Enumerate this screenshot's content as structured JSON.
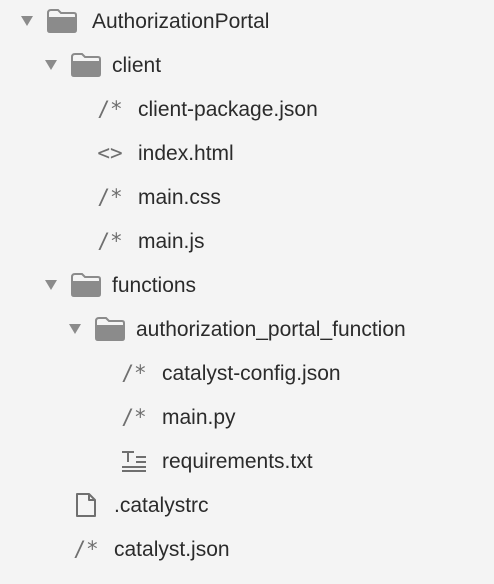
{
  "explorer": {
    "root": {
      "label": "AuthorizationPortal",
      "arrow_icon": "disclosure-expanded-icon",
      "folder_icon": "folder-icon"
    },
    "client": {
      "label": "client",
      "arrow_icon": "disclosure-expanded-icon",
      "folder_icon": "folder-icon",
      "files": [
        {
          "label": "client-package.json",
          "icon": "/*",
          "icon_name": "json-file-icon"
        },
        {
          "label": "index.html",
          "icon": "<>",
          "icon_name": "html-file-icon"
        },
        {
          "label": "main.css",
          "icon": "/*",
          "icon_name": "css-file-icon"
        },
        {
          "label": "main.js",
          "icon": "/*",
          "icon_name": "js-file-icon"
        }
      ]
    },
    "functions": {
      "label": "functions",
      "arrow_icon": "disclosure-expanded-icon",
      "folder_icon": "folder-icon",
      "subfolder": {
        "label": "authorization_portal_function",
        "arrow_icon": "disclosure-expanded-icon",
        "folder_icon": "folder-icon",
        "files": [
          {
            "label": "catalyst-config.json",
            "icon": "/*",
            "icon_name": "json-file-icon"
          },
          {
            "label": "main.py",
            "icon": "/*",
            "icon_name": "python-file-icon"
          },
          {
            "label": "requirements.txt",
            "icon": "text-lines",
            "icon_name": "text-file-icon"
          }
        ]
      }
    },
    "root_files": [
      {
        "label": ".catalystrc",
        "icon": "blank-document",
        "icon_name": "blank-file-icon"
      },
      {
        "label": "catalyst.json",
        "icon": "/*",
        "icon_name": "json-file-icon"
      }
    ]
  },
  "colors": {
    "background": "#f4f4f4",
    "icon_gray": "#8b8b8b",
    "text": "#2b2b2b"
  }
}
